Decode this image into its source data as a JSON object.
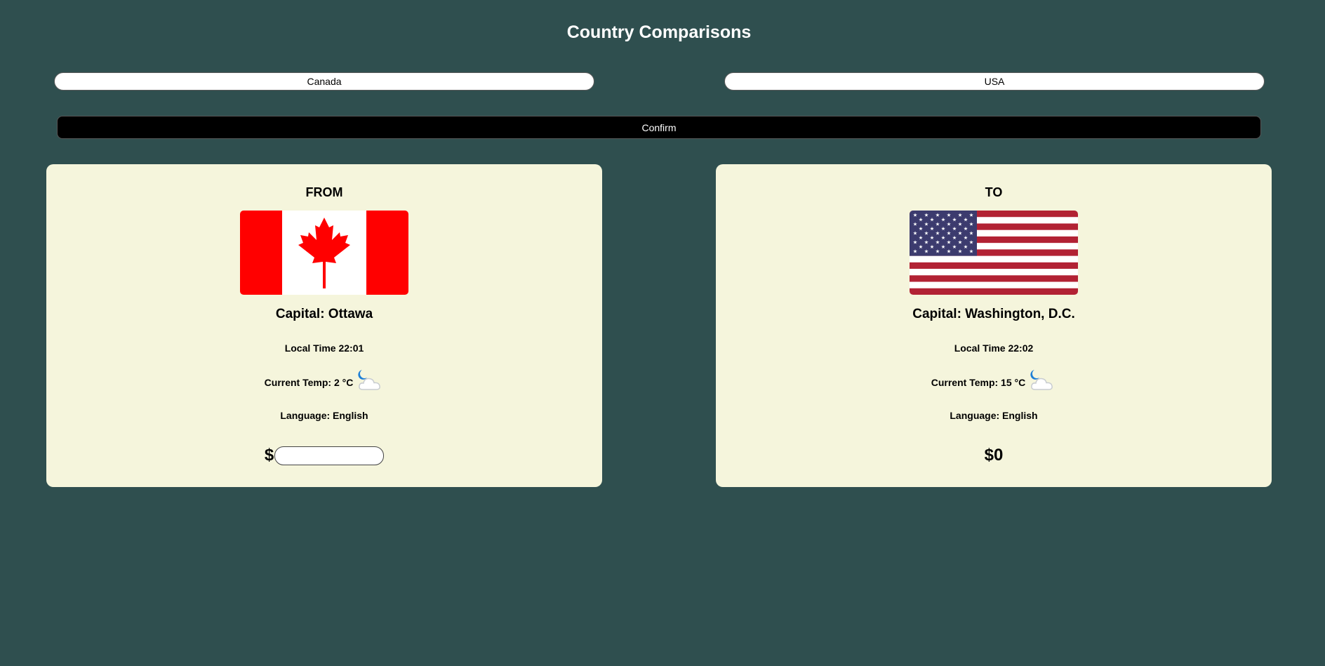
{
  "header": {
    "title": "Country Comparisons"
  },
  "inputs": {
    "from_country": "Canada",
    "to_country": "USA"
  },
  "confirm_label": "Confirm",
  "from_card": {
    "heading": "FROM",
    "flag_icon": "canada-flag-icon",
    "capital": "Capital: Ottawa",
    "local_time": "Local Time 22:01",
    "temp": "Current Temp: 2 °C",
    "weather_icon": "night-cloudy-icon",
    "language": "Language: English",
    "currency_symbol": "$",
    "amount_value": ""
  },
  "to_card": {
    "heading": "TO",
    "flag_icon": "usa-flag-icon",
    "capital": "Capital: Washington, D.C.",
    "local_time": "Local Time 22:02",
    "temp": "Current Temp: 15 °C",
    "weather_icon": "night-cloudy-icon",
    "language": "Language: English",
    "converted_amount": "$0"
  },
  "colors": {
    "background": "#2f4f4f",
    "card": "#f5f5dc",
    "button": "#000000",
    "canada_red": "#ff0000",
    "usa_red": "#b22234",
    "usa_blue": "#3c3b6e"
  }
}
